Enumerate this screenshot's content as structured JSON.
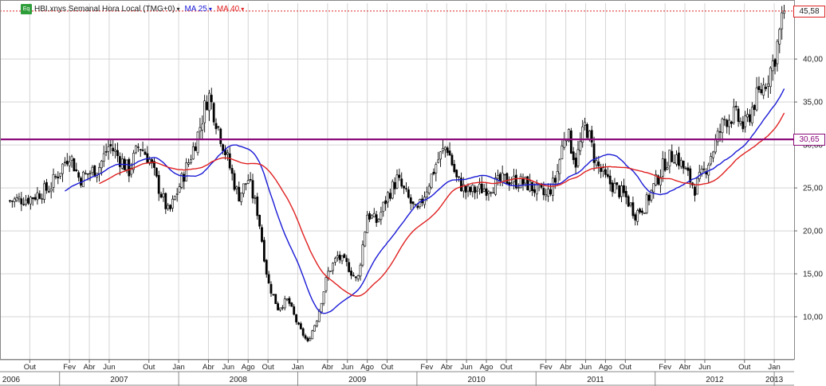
{
  "chart_data": {
    "type": "candlestick",
    "title": "HBI.xnys Semanal Hora Local (TMG+0)",
    "indicators": [
      {
        "name": "MA 25",
        "color": "#1a1ad6"
      },
      {
        "name": "MA 40",
        "color": "#e02020"
      }
    ],
    "y_ticks": [
      "10,00",
      "15,00",
      "20,00",
      "25,00",
      "30,00",
      "35,00",
      "40,00"
    ],
    "ylim": [
      5,
      46.5
    ],
    "last_price": {
      "label": "45,58",
      "value": 45.58
    },
    "horizontal_line": {
      "label": "30,65",
      "value": 30.65,
      "color": "#8b0a7a"
    },
    "close_path": [
      [
        "2006-08",
        23.5
      ],
      [
        "2006-10",
        23.8
      ],
      [
        "2006-12",
        25.0
      ],
      [
        "2007-02",
        29.0
      ],
      [
        "2007-03",
        26.0
      ],
      [
        "2007-05",
        27.5
      ],
      [
        "2007-06",
        30.0
      ],
      [
        "2007-08",
        27.0
      ],
      [
        "2007-09",
        30.0
      ],
      [
        "2007-10",
        28.5
      ],
      [
        "2007-11",
        25.0
      ],
      [
        "2007-12",
        22.0
      ],
      [
        "2008-02",
        28.0
      ],
      [
        "2008-03",
        31.5
      ],
      [
        "2008-04",
        36.0
      ],
      [
        "2008-05",
        32.0
      ],
      [
        "2008-06",
        28.0
      ],
      [
        "2008-07",
        24.0
      ],
      [
        "2008-08",
        26.0
      ],
      [
        "2008-09",
        22.0
      ],
      [
        "2008-10",
        14.0
      ],
      [
        "2008-11",
        11.0
      ],
      [
        "2008-12",
        12.0
      ],
      [
        "2009-01",
        9.0
      ],
      [
        "2009-02",
        7.0
      ],
      [
        "2009-03",
        10.0
      ],
      [
        "2009-04",
        15.0
      ],
      [
        "2009-05",
        17.0
      ],
      [
        "2009-06",
        16.0
      ],
      [
        "2009-07",
        14.0
      ],
      [
        "2009-08",
        22.0
      ],
      [
        "2009-09",
        21.0
      ],
      [
        "2009-10",
        24.0
      ],
      [
        "2009-11",
        26.0
      ],
      [
        "2009-12",
        24.0
      ],
      [
        "2010-01",
        22.0
      ],
      [
        "2010-03",
        28.0
      ],
      [
        "2010-04",
        30.0
      ],
      [
        "2010-05",
        26.0
      ],
      [
        "2010-06",
        24.5
      ],
      [
        "2010-08",
        25.0
      ],
      [
        "2010-10",
        26.0
      ],
      [
        "2010-12",
        25.5
      ],
      [
        "2011-02",
        24.0
      ],
      [
        "2011-03",
        26.0
      ],
      [
        "2011-04",
        32.0
      ],
      [
        "2011-05",
        28.0
      ],
      [
        "2011-06",
        32.5
      ],
      [
        "2011-07",
        28.0
      ],
      [
        "2011-08",
        26.0
      ],
      [
        "2011-09",
        25.0
      ],
      [
        "2011-10",
        24.0
      ],
      [
        "2011-11",
        22.0
      ],
      [
        "2011-12",
        23.0
      ],
      [
        "2012-02",
        28.0
      ],
      [
        "2012-03",
        29.0
      ],
      [
        "2012-04",
        27.0
      ],
      [
        "2012-05",
        25.0
      ],
      [
        "2012-06",
        27.0
      ],
      [
        "2012-07",
        30.0
      ],
      [
        "2012-08",
        33.0
      ],
      [
        "2012-09",
        33.5
      ],
      [
        "2012-10",
        32.0
      ],
      [
        "2012-11",
        35.0
      ],
      [
        "2012-12",
        37.0
      ],
      [
        "2013-01",
        40.0
      ],
      [
        "2013-02",
        45.58
      ]
    ],
    "x_month_ticks": [
      {
        "date": "2006-10",
        "label": "Out"
      },
      {
        "date": "2007-02",
        "label": "Fev"
      },
      {
        "date": "2007-04",
        "label": "Abr"
      },
      {
        "date": "2007-06",
        "label": "Jun"
      },
      {
        "date": "2007-10",
        "label": "Out"
      },
      {
        "date": "2008-01",
        "label": "Jan"
      },
      {
        "date": "2008-04",
        "label": "Abr"
      },
      {
        "date": "2008-06",
        "label": "Jun"
      },
      {
        "date": "2008-08",
        "label": "Ago"
      },
      {
        "date": "2008-10",
        "label": "Out"
      },
      {
        "date": "2009-01",
        "label": "Jan"
      },
      {
        "date": "2009-04",
        "label": "Abr"
      },
      {
        "date": "2009-06",
        "label": "Jun"
      },
      {
        "date": "2009-08",
        "label": "Ago"
      },
      {
        "date": "2009-10",
        "label": "Out"
      },
      {
        "date": "2010-02",
        "label": "Fev"
      },
      {
        "date": "2010-04",
        "label": "Abr"
      },
      {
        "date": "2010-06",
        "label": "Jun"
      },
      {
        "date": "2010-08",
        "label": "Ago"
      },
      {
        "date": "2010-10",
        "label": "Out"
      },
      {
        "date": "2011-02",
        "label": "Fev"
      },
      {
        "date": "2011-04",
        "label": "Abr"
      },
      {
        "date": "2011-06",
        "label": "Jun"
      },
      {
        "date": "2011-08",
        "label": "Ago"
      },
      {
        "date": "2011-10",
        "label": "Out"
      },
      {
        "date": "2012-02",
        "label": "Fev"
      },
      {
        "date": "2012-04",
        "label": "Abr"
      },
      {
        "date": "2012-06",
        "label": "Jun"
      },
      {
        "date": "2012-10",
        "label": "Out"
      },
      {
        "date": "2013-01",
        "label": "Jan"
      }
    ],
    "x_year_labels": [
      {
        "year": "2006",
        "center": "2006-08"
      },
      {
        "year": "2007",
        "center": "2007-07"
      },
      {
        "year": "2008",
        "center": "2008-07"
      },
      {
        "year": "2009",
        "center": "2009-07"
      },
      {
        "year": "2010",
        "center": "2010-07"
      },
      {
        "year": "2011",
        "center": "2011-07"
      },
      {
        "year": "2012",
        "center": "2012-07"
      },
      {
        "year": "2013",
        "center": "2013-01"
      }
    ],
    "x_year_separators": [
      "2007-01",
      "2008-01",
      "2009-01",
      "2010-01",
      "2011-01",
      "2012-01",
      "2013-01"
    ],
    "xlim": [
      "2006-07",
      "2013-03"
    ],
    "grid": true,
    "colors": {
      "up": "#ffffff",
      "down": "#000000",
      "ma25": "#1a1ad6",
      "ma40": "#e02020",
      "line": "#8b0a7a"
    }
  }
}
